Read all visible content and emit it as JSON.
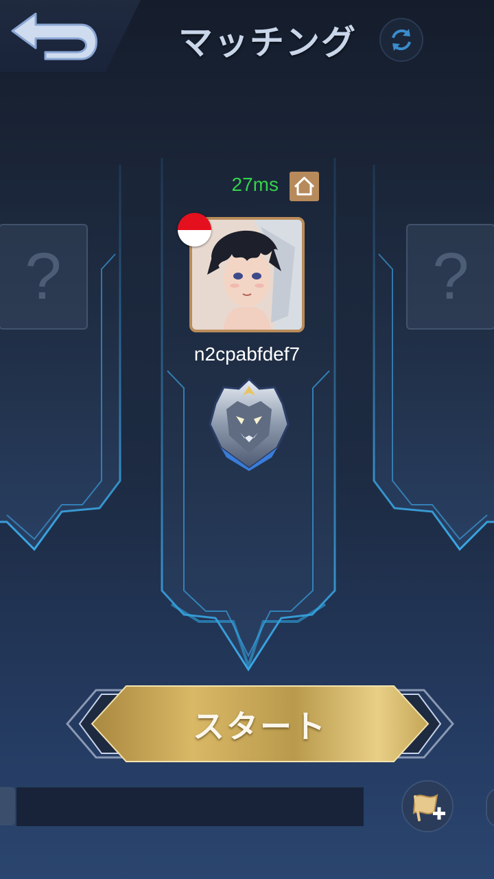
{
  "header": {
    "title": "マッチング",
    "back_icon": "back-arrow-icon",
    "refresh_icon": "refresh-icon"
  },
  "player": {
    "ping": "27ms",
    "ping_color": "#35d24a",
    "home_icon": "home-icon",
    "flag_icon": "indonesia-flag-icon",
    "username": "n2cpabfdef7",
    "rank_icon": "rank-emblem-icon"
  },
  "empty_slots": {
    "left_mark": "?",
    "right_mark": "?"
  },
  "actions": {
    "start_label": "スタート",
    "add_icon": "flag-plus-icon"
  },
  "colors": {
    "accent_blue": "#2fa5e0",
    "gold": "#c9a44e"
  }
}
